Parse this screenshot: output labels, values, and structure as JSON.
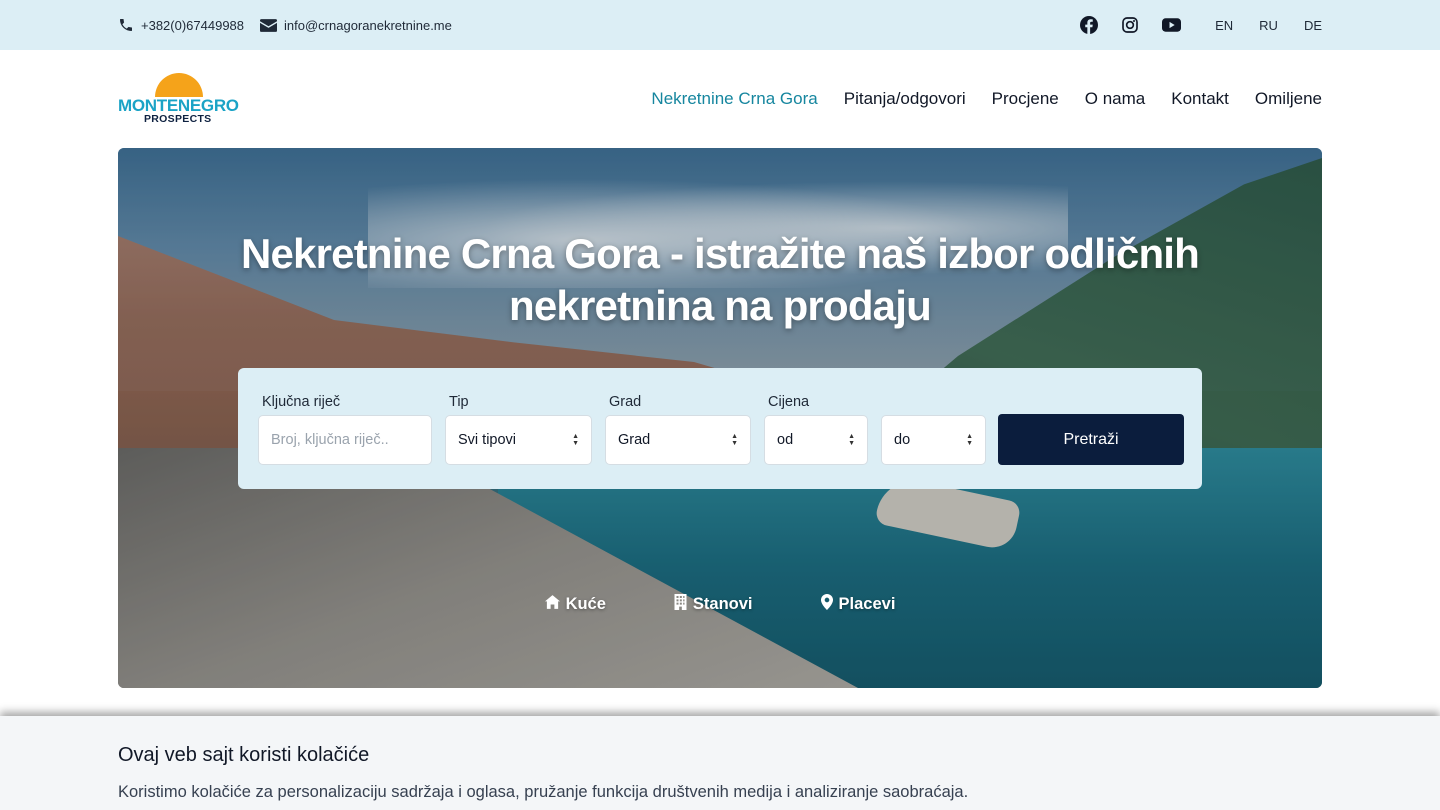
{
  "topbar": {
    "phone": "+382(0)67449988",
    "email": "info@crnagoranekretnine.me",
    "phone_icon": "phone-icon",
    "email_icon": "envelope-icon",
    "socials": [
      "facebook-icon",
      "instagram-icon",
      "youtube-icon"
    ],
    "languages": [
      "EN",
      "RU",
      "DE"
    ]
  },
  "logo": {
    "main": "MONTENEGRO",
    "sub": "PROSPECTS"
  },
  "nav": {
    "items": [
      {
        "label": "Nekretnine Crna Gora",
        "active": true
      },
      {
        "label": "Pitanja/odgovori"
      },
      {
        "label": "Procjene"
      },
      {
        "label": "O nama"
      },
      {
        "label": "Kontakt"
      },
      {
        "label": "Omiljene"
      }
    ]
  },
  "hero": {
    "title_line1": "Nekretnine Crna Gora - istražite naš izbor odličnih",
    "title_line2": "nekretnina na prodaju"
  },
  "search": {
    "keyword_label": "Ključna riječ",
    "keyword_placeholder": "Broj, ključna riječ..",
    "type_label": "Tip",
    "type_value": "Svi tipovi",
    "city_label": "Grad",
    "city_value": "Grad",
    "price_label": "Cijena",
    "price_from": "od",
    "price_to": "do",
    "submit": "Pretraži"
  },
  "categories": [
    {
      "label": "Kuće",
      "icon": "house-icon"
    },
    {
      "label": "Stanovi",
      "icon": "building-icon"
    },
    {
      "label": "Placevi",
      "icon": "map-pin-icon"
    }
  ],
  "cookie": {
    "title": "Ovaj veb sajt koristi kolačiće",
    "text": "Koristimo kolačiće za personalizaciju sadržaja i oglasa, pružanje funkcija društvenih medija i analiziranje saobraćaja."
  },
  "colors": {
    "topbar_bg": "#dceef5",
    "accent": "#16869f",
    "button": "#0b1d3d",
    "logo_sun": "#f5a31a"
  }
}
